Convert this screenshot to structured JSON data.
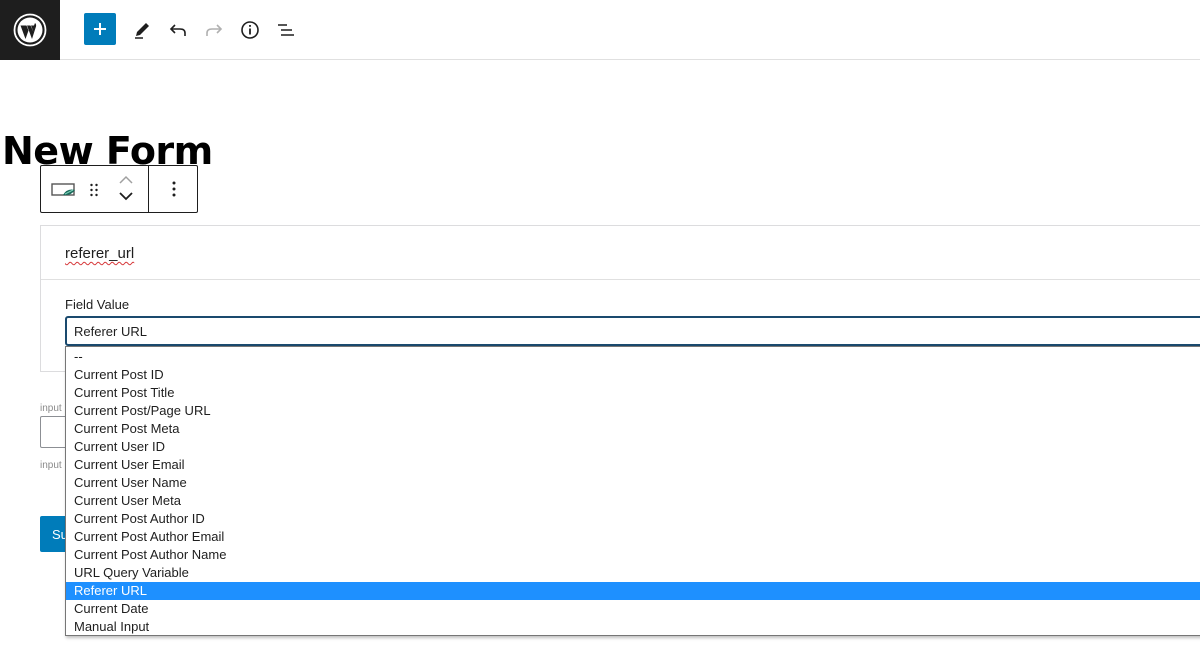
{
  "toolbar": {
    "logo_icon": "wordpress-logo-icon",
    "add_icon": "plus-icon",
    "edit_icon": "pencil-icon",
    "undo_icon": "undo-icon",
    "redo_icon": "redo-icon",
    "info_icon": "info-icon",
    "list_icon": "list-view-icon"
  },
  "post": {
    "title": "New Form"
  },
  "block_toolbar": {
    "block_icon": "form-block-icon",
    "drag_icon": "drag-handle-icon",
    "move_up_icon": "chevron-up-icon",
    "move_down_icon": "chevron-down-icon",
    "more_icon": "more-vertical-icon"
  },
  "block": {
    "field_name": "referer_url",
    "field_value_label": "Field Value",
    "selected_value": "Referer URL"
  },
  "background": {
    "input_label_top": "input",
    "input_label_bottom": "input",
    "submit_label": "Su"
  },
  "dropdown": {
    "options": [
      "--",
      "Current Post ID",
      "Current Post Title",
      "Current Post/Page URL",
      "Current Post Meta",
      "Current User ID",
      "Current User Email",
      "Current User Name",
      "Current User Meta",
      "Current Post Author ID",
      "Current Post Author Email",
      "Current Post Author Name",
      "URL Query Variable",
      "Referer URL",
      "Current Date",
      "Manual Input"
    ],
    "selected_index": 13
  },
  "colors": {
    "accent": "#007cba",
    "selected_option": "#1e90ff",
    "dark": "#1e1e1e"
  }
}
